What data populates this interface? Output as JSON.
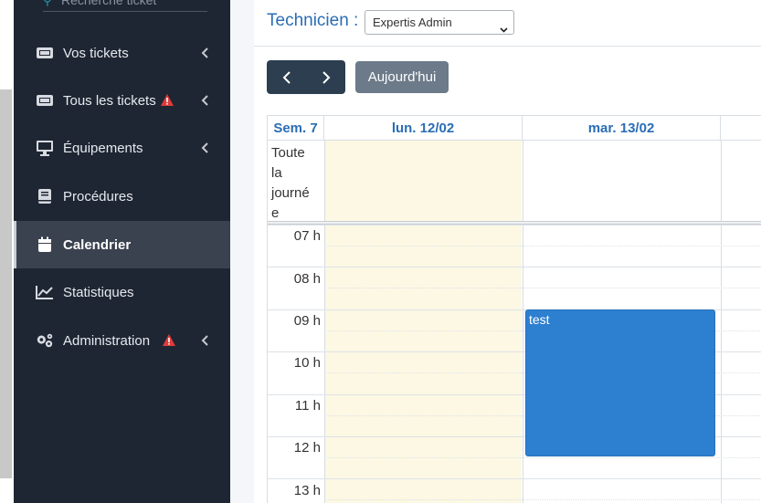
{
  "sidebar": {
    "search_placeholder": "Recherche ticket",
    "items": [
      {
        "label": "Vos tickets",
        "icon": "ticket-icon",
        "has_chevron": true,
        "warning": false
      },
      {
        "label": "Tous les tickets",
        "icon": "ticket-icon",
        "has_chevron": true,
        "warning": true
      },
      {
        "label": "Équipements",
        "icon": "desktop-icon",
        "has_chevron": true,
        "warning": false
      },
      {
        "label": "Procédures",
        "icon": "book-icon",
        "has_chevron": false,
        "warning": false
      },
      {
        "label": "Calendrier",
        "icon": "calendar-icon",
        "has_chevron": false,
        "warning": false,
        "active": true
      },
      {
        "label": "Statistiques",
        "icon": "chart-line-icon",
        "has_chevron": false,
        "warning": false
      },
      {
        "label": "Administration",
        "icon": "gears-icon",
        "has_chevron": true,
        "warning": true
      }
    ]
  },
  "toolbar": {
    "technician_label": "Technicien :",
    "technician_value": "Expertis Admin",
    "today_label": "Aujourd'hui"
  },
  "calendar": {
    "week_label": "Sem. 7",
    "days": [
      "lun. 12/02",
      "mar. 13/02"
    ],
    "allday_label": [
      "Toute",
      "la",
      "journé",
      "e"
    ],
    "hours": [
      "07 h",
      "08 h",
      "09 h",
      "10 h",
      "11 h",
      "12 h",
      "13 h"
    ],
    "event_title": "test"
  },
  "colors": {
    "sidebar_bg": "#1f2633",
    "accent": "#2a6db5",
    "event": "#2d7fd0",
    "today_bg": "#fcf8e3",
    "warning": "#e03a3a"
  }
}
